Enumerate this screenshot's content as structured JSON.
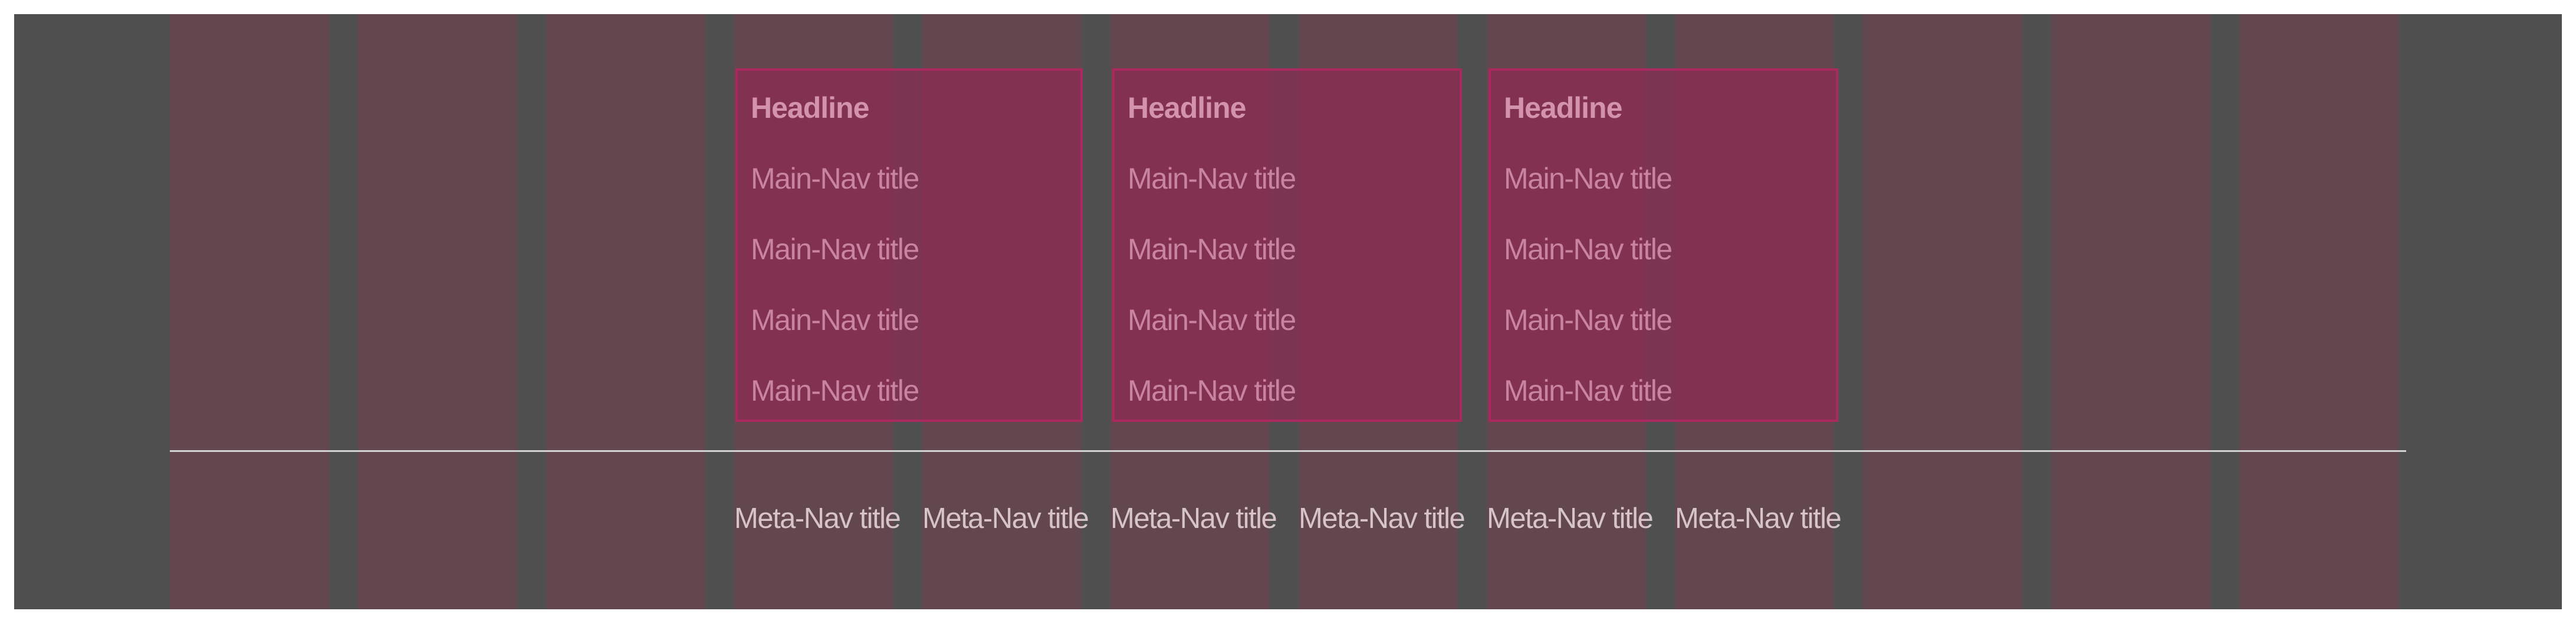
{
  "colors": {
    "background": "#4f4f4f",
    "grid_column": "#62474e",
    "nav_block": "#9b2355",
    "headline_text": "#d394ab",
    "nav_item_text": "#c884a0",
    "meta_text": "#d6c4c9",
    "divider": "#d2d2d2"
  },
  "main_nav": [
    {
      "headline": "Headline",
      "items": [
        "Main-Nav title",
        "Main-Nav title",
        "Main-Nav title",
        "Main-Nav title"
      ]
    },
    {
      "headline": "Headline",
      "items": [
        "Main-Nav title",
        "Main-Nav title",
        "Main-Nav title",
        "Main-Nav title"
      ]
    },
    {
      "headline": "Headline",
      "items": [
        "Main-Nav title",
        "Main-Nav title",
        "Main-Nav title",
        "Main-Nav title"
      ]
    }
  ],
  "meta_nav": [
    "Meta-Nav title",
    "Meta-Nav title",
    "Meta-Nav title",
    "Meta-Nav title",
    "Meta-Nav title",
    "Meta-Nav title"
  ]
}
